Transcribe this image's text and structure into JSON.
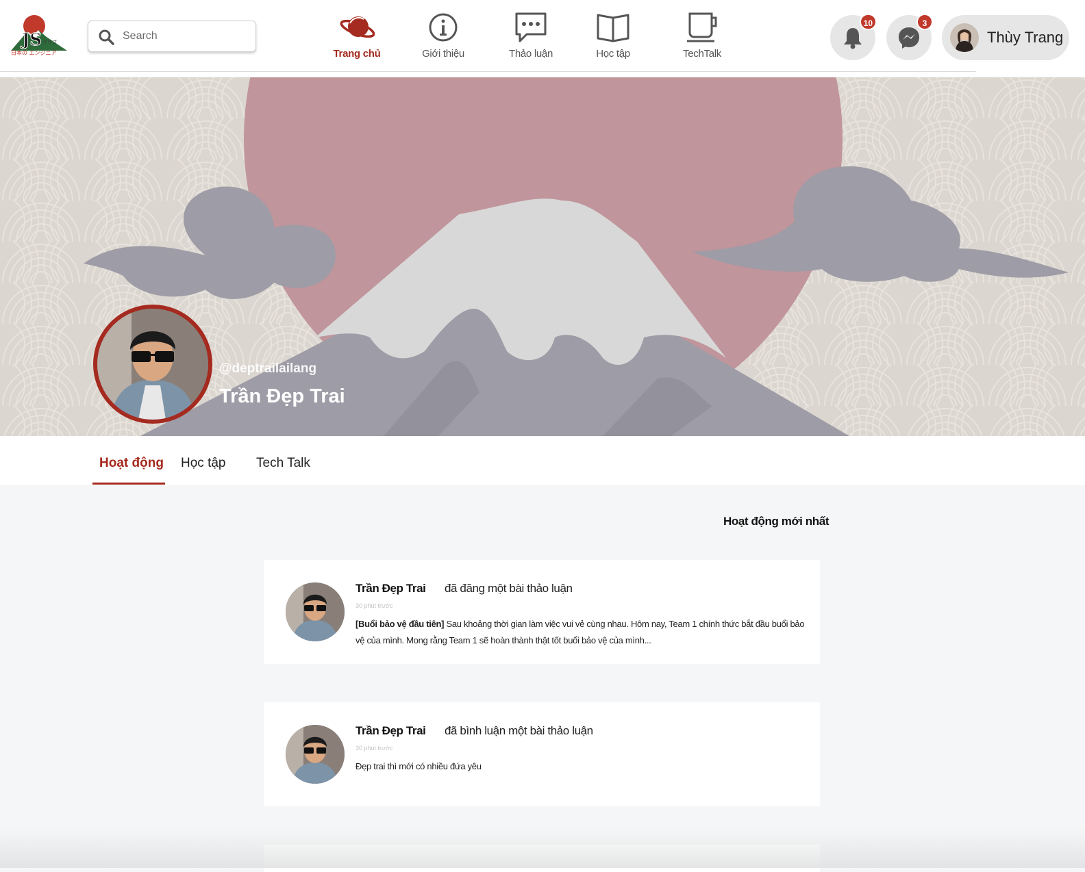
{
  "header": {
    "logo": {
      "name": "JS-club-logo",
      "text": "日本の エンジニア",
      "brand_text": "JS",
      "small_text": "クラブ"
    },
    "search": {
      "placeholder": "Search"
    },
    "nav": [
      {
        "label": "Trang chủ",
        "icon": "planet-icon",
        "active": true
      },
      {
        "label": "Giới thiệu",
        "icon": "info-icon",
        "active": false
      },
      {
        "label": "Thảo luận",
        "icon": "chat-bubble-icon",
        "active": false
      },
      {
        "label": "Học tập",
        "icon": "book-icon",
        "active": false
      },
      {
        "label": "TechTalk",
        "icon": "cup-icon",
        "active": false
      }
    ],
    "notifications": {
      "icon": "bell-icon",
      "count": "10"
    },
    "messages": {
      "icon": "messenger-icon",
      "count": "3"
    },
    "user": {
      "name": "Thùy Trang",
      "icon": "user-avatar"
    }
  },
  "profile": {
    "handle": "@deptrailailang",
    "name": "Trần Đẹp Trai"
  },
  "tabs": [
    {
      "label": "Hoạt động",
      "active": true
    },
    {
      "label": "Học tập",
      "active": false
    },
    {
      "label": "Tech Talk",
      "active": false
    }
  ],
  "activity": {
    "title": "Hoạt động mới nhất",
    "items": [
      {
        "author": "Trần Đẹp Trai",
        "action": "đã đăng một bài thảo luận",
        "time": "30 phút trước",
        "tag": "[Buổi bảo vệ đầu tiên]",
        "text": "Sau khoảng thời gian làm việc vui vẻ cùng nhau. Hôm nay, Team 1 chính thức bắt đầu buổi bảo vệ của mình. Mong rằng Team 1 sẽ hoàn thành thật tốt buổi bảo vệ của mình..."
      },
      {
        "author": "Trần Đẹp Trai",
        "action": "đã bình luận một bài thảo luận",
        "time": "30 phút trước",
        "tag": "",
        "text": "Đẹp trai thì mới có nhiều đứa yêu"
      }
    ]
  },
  "colors": {
    "accent": "#a52a1f",
    "cover_bg": "#dcd6d0",
    "sun": "#c0959b",
    "cloud": "#9e9ca6",
    "snow": "#d8d8d8",
    "mountain": "#9e9ca6"
  }
}
